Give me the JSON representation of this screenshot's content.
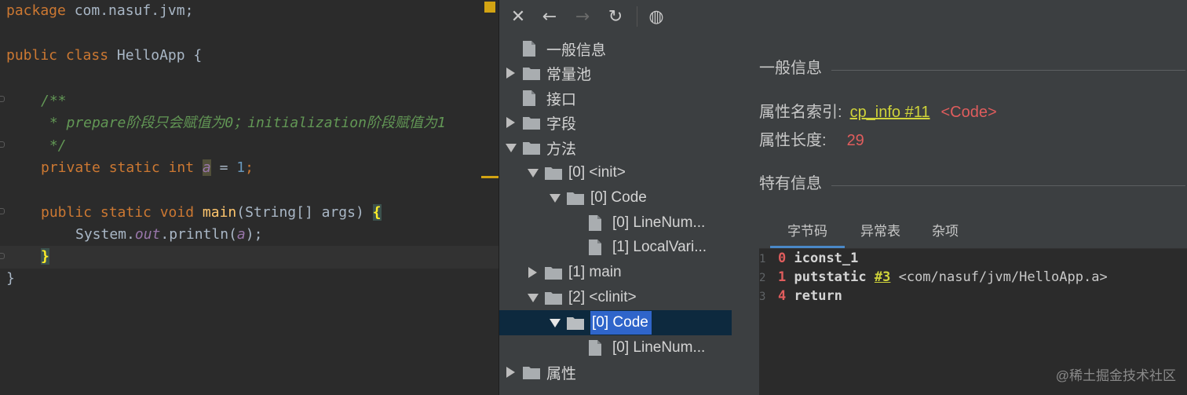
{
  "editor": {
    "lines": {
      "l1": {
        "kw": "package",
        "rest": " com.nasuf.jvm;"
      },
      "l2": {
        "kw1": "public",
        "kw2": "class",
        "name": " HelloApp {"
      },
      "l3": {
        "doc": "/**"
      },
      "l4": {
        "doc": " * prepare阶段只会赋值为0；initialization阶段赋值为1"
      },
      "l5": {
        "doc": " */"
      },
      "l6": {
        "kw": "private static int ",
        "var": "a",
        "eq": " = ",
        "num": "1",
        "semi": ";"
      },
      "l7": {
        "kw": "public static void ",
        "method": "main",
        "params": "(String[] args) ",
        "brace": "{"
      },
      "l8": {
        "pre": "System.",
        "field": "out",
        "mid": ".println(",
        "arg": "a",
        "post": ");"
      },
      "l9": {
        "brace": "}"
      },
      "l10": {
        "brace": "}"
      }
    }
  },
  "toolbar": {
    "close_glyph": "✕",
    "back_glyph": "←",
    "forward_glyph": "→",
    "refresh_glyph": "↻",
    "web_glyph": "◍"
  },
  "tree": {
    "items": [
      {
        "label": "一般信息"
      },
      {
        "label": "常量池"
      },
      {
        "label": "接口"
      },
      {
        "label": "字段"
      },
      {
        "label": "方法"
      },
      {
        "label": "[0] <init>"
      },
      {
        "label": "[0] Code"
      },
      {
        "label": "[0] LineNum..."
      },
      {
        "label": "[1] LocalVari..."
      },
      {
        "label": "[1] main"
      },
      {
        "label": "[2] <clinit>"
      },
      {
        "label": "[0] Code"
      },
      {
        "label": "[0] LineNum..."
      },
      {
        "label": "属性"
      }
    ]
  },
  "panel": {
    "general_title": "一般信息",
    "name_index_label": "属性名索引:",
    "name_index_link": "cp_info #11",
    "name_index_value": "<Code>",
    "length_label": "属性长度:",
    "length_value": "29",
    "specific_title": "特有信息",
    "tabs": [
      {
        "label": "字节码"
      },
      {
        "label": "异常表"
      },
      {
        "label": "杂项"
      }
    ]
  },
  "bytecode": {
    "lines": [
      {
        "num": "1",
        "offset": "0",
        "op": "iconst_1",
        "ref": "",
        "arg": ""
      },
      {
        "num": "2",
        "offset": "1",
        "op": "putstatic",
        "ref": "#3",
        "arg": " <com/nasuf/jvm/HelloApp.a>"
      },
      {
        "num": "3",
        "offset": "4",
        "op": "return",
        "ref": "",
        "arg": ""
      }
    ]
  },
  "watermark": "@稀土掘金技术社区",
  "colors": {
    "editor_bg": "#2b2b2b",
    "panel_bg": "#3c3f41",
    "keyword": "#cc7832",
    "doc_comment": "#629755",
    "number": "#6897bb",
    "selection": "#2f65ca",
    "link": "#cfd33a",
    "value_red": "#e05d5d"
  }
}
